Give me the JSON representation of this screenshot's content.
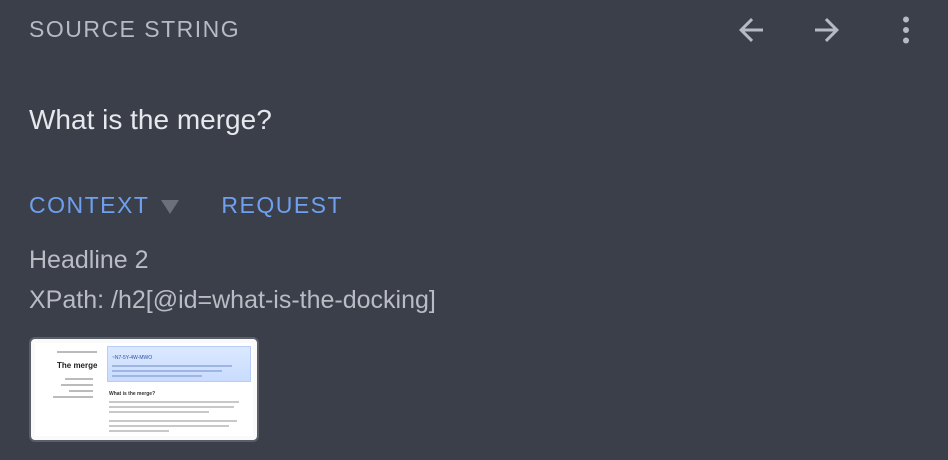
{
  "header": {
    "section_label": "SOURCE STRING",
    "back_icon": "arrow-left-icon",
    "forward_icon": "arrow-right-icon",
    "menu_icon": "more-vertical-icon"
  },
  "source": {
    "text": "What is the merge?"
  },
  "tabs": [
    {
      "label": "CONTEXT",
      "selected": true,
      "has_dropdown": true
    },
    {
      "label": "REQUEST",
      "selected": false
    }
  ],
  "context": {
    "element_type": "Headline 2",
    "xpath": "XPath: /h2[@id=what-is-the-docking]",
    "screenshot_thumbnail": {
      "title": "The merge",
      "banner_title": "~N7-5Y-4W-MWO",
      "heading": "What is the merge?"
    }
  },
  "colors": {
    "background": "#3a3f4a",
    "accent": "#6fa0f0",
    "muted_text": "#b6bac2",
    "primary_text": "#e6e8ec"
  }
}
